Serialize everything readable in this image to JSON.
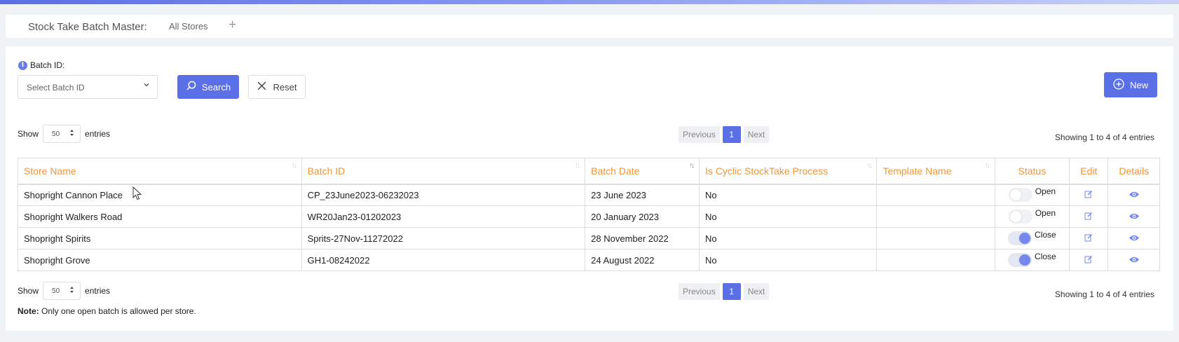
{
  "header": {
    "title": "Stock Take Batch Master:",
    "tab": "All Stores",
    "add": "+"
  },
  "filter": {
    "label": "Batch ID:",
    "select_placeholder": "Select Batch ID",
    "search_label": "Search",
    "reset_label": "Reset",
    "new_label": "New"
  },
  "length": {
    "show": "Show",
    "value": "50",
    "entries": "entries"
  },
  "pagination": {
    "previous": "Previous",
    "page": "1",
    "next": "Next"
  },
  "info": "Showing 1 to 4 of 4 entries",
  "table": {
    "columns": [
      "Store Name",
      "Batch ID",
      "Batch Date",
      "Is Cyclic StockTake Process",
      "Template Name",
      "Status",
      "Edit",
      "Details"
    ],
    "rows": [
      {
        "store": "Shopright Cannon Place",
        "batch_id": "CP_23June2023-06232023",
        "date": "23 June 2023",
        "cyclic": "No",
        "template": "",
        "status": "Open",
        "status_on": false
      },
      {
        "store": "Shopright Walkers Road",
        "batch_id": "WR20Jan23-01202023",
        "date": "20 January 2023",
        "cyclic": "No",
        "template": "",
        "status": "Open",
        "status_on": false
      },
      {
        "store": "Shopright Spirits",
        "batch_id": "Sprits-27Nov-11272022",
        "date": "28 November 2022",
        "cyclic": "No",
        "template": "",
        "status": "Close",
        "status_on": true
      },
      {
        "store": "Shopright Grove",
        "batch_id": "GH1-08242022",
        "date": "24 August 2022",
        "cyclic": "No",
        "template": "",
        "status": "Close",
        "status_on": true
      }
    ]
  },
  "note": {
    "label": "Note:",
    "text": " Only one open batch is allowed per store."
  },
  "colors": {
    "accent": "#5b6fe6",
    "header_text": "#f0953a"
  },
  "icons": [
    "info-icon",
    "search-icon",
    "close-icon",
    "plus-circle-icon",
    "sort-icon",
    "edit-icon",
    "eye-icon",
    "mouse-cursor-icon"
  ]
}
